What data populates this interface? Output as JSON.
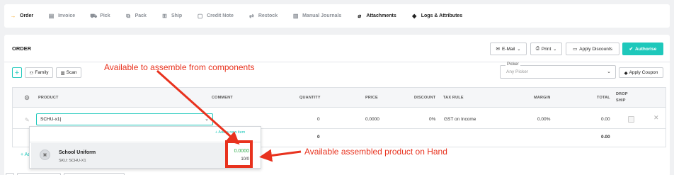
{
  "tabs": [
    {
      "label": "Order",
      "icon": "arrow-right-icon"
    },
    {
      "label": "Invoice",
      "icon": "invoice-icon"
    },
    {
      "label": "Pick",
      "icon": "cart-icon"
    },
    {
      "label": "Pack",
      "icon": "pack-icon"
    },
    {
      "label": "Ship",
      "icon": "truck-icon"
    },
    {
      "label": "Credit Note",
      "icon": "credit-note-icon"
    },
    {
      "label": "Restock",
      "icon": "restock-icon"
    },
    {
      "label": "Manual Journals",
      "icon": "journal-icon"
    },
    {
      "label": "Attachments",
      "icon": "paperclip-icon"
    },
    {
      "label": "Logs & Attributes",
      "icon": "tag-icon"
    }
  ],
  "order": {
    "title": "ORDER",
    "email_label": "E-Mail",
    "print_label": "Print",
    "apply_discounts_label": "Apply Discounts",
    "authorise_label": "Authorise",
    "family_label": "Family",
    "scan_label": "Scan",
    "picker_label": "Picker",
    "picker_placeholder": "Any Picker",
    "apply_coupon_label": "Apply Coupon"
  },
  "table": {
    "headers": {
      "product": "PRODUCT",
      "comment": "COMMENT",
      "quantity": "QUANTITY",
      "price": "PRICE",
      "discount": "DISCOUNT",
      "tax_rule": "TAX RULE",
      "margin": "MARGIN",
      "total": "TOTAL",
      "drop_ship_1": "DROP",
      "drop_ship_2": "SHIP"
    },
    "row": {
      "product": "SCHU-x1|",
      "quantity": "0",
      "price": "0.0000",
      "discount": "0%",
      "tax_rule": "GST on Income",
      "margin": "0.00%",
      "total": "0.00"
    },
    "totals": {
      "quantity": "0",
      "total": "0.00"
    }
  },
  "dropdown": {
    "add_new": "+ Add a new item",
    "item": {
      "name": "School Uniform",
      "sku": "SKU: SCHU-X1",
      "price": "0.0000",
      "stock": "10/0"
    }
  },
  "add_link": "+ Add",
  "annotations": {
    "top": "Available to assemble from components",
    "right": "Available assembled product on Hand"
  },
  "colors": {
    "accent": "#1ec8bb",
    "annotation": "#e8321e",
    "price_green": "#2eaa4a",
    "active_tab_icon": "#f5a623"
  }
}
